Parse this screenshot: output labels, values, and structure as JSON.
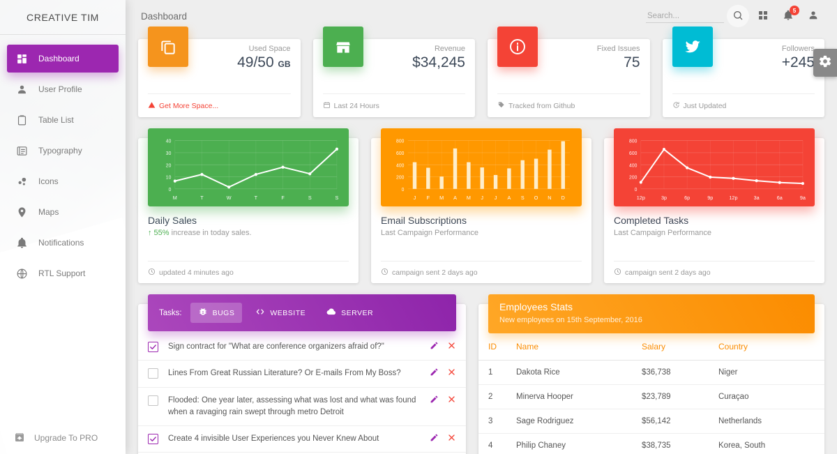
{
  "sidebar": {
    "brand": "CREATIVE TIM",
    "items": [
      {
        "label": "Dashboard",
        "icon": "dashboard-icon",
        "active": true
      },
      {
        "label": "User Profile",
        "icon": "person-icon",
        "active": false
      },
      {
        "label": "Table List",
        "icon": "clipboard-icon",
        "active": false
      },
      {
        "label": "Typography",
        "icon": "typography-icon",
        "active": false
      },
      {
        "label": "Icons",
        "icon": "bubble-chart-icon",
        "active": false
      },
      {
        "label": "Maps",
        "icon": "location-pin-icon",
        "active": false
      },
      {
        "label": "Notifications",
        "icon": "bell-icon",
        "active": false
      },
      {
        "label": "RTL Support",
        "icon": "globe-icon",
        "active": false
      }
    ],
    "upgrade": {
      "label": "Upgrade To PRO",
      "icon": "unarchive-icon"
    }
  },
  "navbar": {
    "title": "Dashboard",
    "search": {
      "placeholder": "Search...",
      "value": ""
    },
    "search_button_icon": "search-icon",
    "apps_icon": "apps-grid-icon",
    "notifications_icon": "bell-icon",
    "notifications_count": "5",
    "profile_icon": "person-icon",
    "settings_icon": "gear-icon"
  },
  "stat_cards": [
    {
      "icon": "content-copy-icon",
      "color": "#f5941d",
      "category": "Used Space",
      "value": "49/50",
      "unit": "GB",
      "footer": "Get More Space...",
      "footer_icon": "warning-icon",
      "footer_warn": true
    },
    {
      "icon": "store-icon",
      "color": "#4caf50",
      "category": "Revenue",
      "value": "$34,245",
      "unit": "",
      "footer": "Last 24 Hours",
      "footer_icon": "calendar-icon",
      "footer_warn": false
    },
    {
      "icon": "info-icon",
      "color": "#f44336",
      "category": "Fixed Issues",
      "value": "75",
      "unit": "",
      "footer": "Tracked from Github",
      "footer_icon": "tag-icon",
      "footer_warn": false
    },
    {
      "icon": "twitter-icon",
      "color": "#00bcd4",
      "category": "Followers",
      "value": "+245",
      "unit": "",
      "footer": "Just Updated",
      "footer_icon": "update-icon",
      "footer_warn": false
    }
  ],
  "chart_data": [
    {
      "type": "line",
      "title": "Daily Sales",
      "subtitle": "55% increase in today sales.",
      "subtitle_prefix": "↑",
      "subtitle_highlight": "55%",
      "footer": "updated 4 minutes ago",
      "footer_icon": "clock-icon",
      "color": "#4caf50",
      "categories": [
        "M",
        "T",
        "W",
        "T",
        "F",
        "S",
        "S"
      ],
      "values": [
        6.5,
        12,
        1.5,
        12,
        18,
        12.5,
        33
      ],
      "ylim": [
        0,
        40
      ],
      "yticks": [
        0,
        10,
        20,
        30,
        40
      ],
      "xlabel": "",
      "ylabel": "",
      "grid": true,
      "legend": "none"
    },
    {
      "type": "bar",
      "title": "Email Subscriptions",
      "subtitle": "Last Campaign Performance",
      "footer": "campaign sent 2 days ago",
      "footer_icon": "clock-icon",
      "color": "#ff9800",
      "categories": [
        "J",
        "F",
        "M",
        "A",
        "M",
        "J",
        "J",
        "A",
        "S",
        "O",
        "N",
        "D"
      ],
      "values": [
        442,
        350,
        205,
        670,
        442,
        355,
        230,
        340,
        475,
        500,
        650,
        790
      ],
      "ylim": [
        0,
        800
      ],
      "yticks": [
        0,
        200,
        400,
        600,
        800
      ],
      "xlabel": "",
      "ylabel": "",
      "grid": true,
      "legend": "none"
    },
    {
      "type": "line",
      "title": "Completed Tasks",
      "subtitle": "Last Campaign Performance",
      "footer": "campaign sent 2 days ago",
      "footer_icon": "clock-icon",
      "color": "#f44336",
      "categories": [
        "12p",
        "3p",
        "6p",
        "9p",
        "12p",
        "3a",
        "6a",
        "9a"
      ],
      "values": [
        110,
        655,
        350,
        195,
        175,
        135,
        105,
        90
      ],
      "ylim": [
        0,
        800
      ],
      "yticks": [
        0,
        200,
        400,
        600,
        800
      ],
      "xlabel": "",
      "ylabel": "",
      "grid": true,
      "legend": "none"
    }
  ],
  "tasks_panel": {
    "label": "Tasks:",
    "tabs": [
      {
        "label": "BUGS",
        "icon": "bug-icon",
        "active": true
      },
      {
        "label": "WEBSITE",
        "icon": "code-icon",
        "active": false
      },
      {
        "label": "SERVER",
        "icon": "cloud-icon",
        "active": false
      }
    ],
    "rows": [
      {
        "checked": true,
        "text": "Sign contract for \"What are conference organizers afraid of?\""
      },
      {
        "checked": false,
        "text": "Lines From Great Russian Literature? Or E-mails From My Boss?"
      },
      {
        "checked": false,
        "text": "Flooded: One year later, assessing what was lost and what was found when a ravaging rain swept through metro Detroit"
      },
      {
        "checked": true,
        "text": "Create 4 invisible User Experiences you Never Knew About"
      }
    ],
    "edit_icon": "pencil-icon",
    "delete_icon": "close-icon"
  },
  "employees_panel": {
    "title": "Employees Stats",
    "subtitle": "New employees on 15th September, 2016",
    "columns": [
      "ID",
      "Name",
      "Salary",
      "Country"
    ],
    "rows": [
      [
        "1",
        "Dakota Rice",
        "$36,738",
        "Niger"
      ],
      [
        "2",
        "Minerva Hooper",
        "$23,789",
        "Curaçao"
      ],
      [
        "3",
        "Sage Rodriguez",
        "$56,142",
        "Netherlands"
      ],
      [
        "4",
        "Philip Chaney",
        "$38,735",
        "Korea, South"
      ]
    ]
  }
}
